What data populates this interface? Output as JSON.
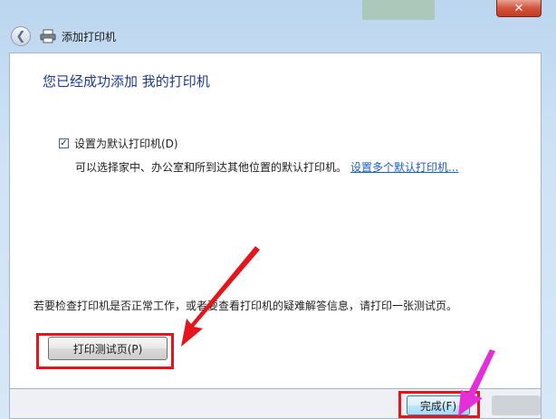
{
  "window": {
    "title": "添加打印机",
    "close_glyph": "✕"
  },
  "nav": {
    "back_glyph": "❮"
  },
  "content": {
    "heading": "您已经成功添加 我的打印机",
    "default_checkbox": {
      "label": "设置为默认打印机(D)",
      "checked": true,
      "check_glyph": "✓"
    },
    "description": "可以选择家中、办公室和所到达其他位置的默认打印机。",
    "link": "设置多个默认打印机...",
    "test_info": "若要检查打印机是否正常工作，或者要查看打印机的疑难解答信息，请打印一张测试页。",
    "test_button": "打印测试页(P)"
  },
  "footer": {
    "finish_button": "完成(F)"
  },
  "annotations": {
    "highlight_color": "#e8141b",
    "arrow1_color": "#e8141b",
    "arrow2_color": "#e22fd8"
  }
}
